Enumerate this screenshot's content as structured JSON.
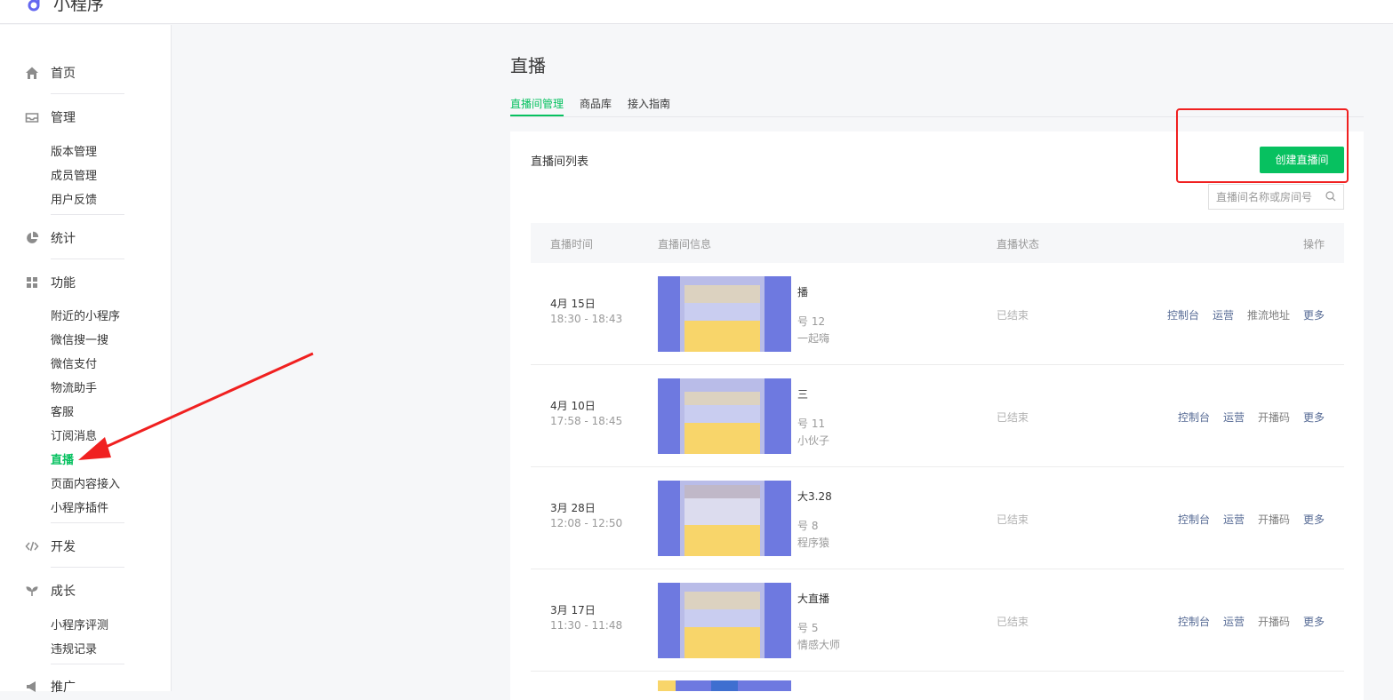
{
  "app": {
    "brand": "小程序"
  },
  "sidebar": {
    "groups": [
      {
        "label": "首页",
        "icon": "home-icon",
        "items": []
      },
      {
        "label": "管理",
        "icon": "inbox-icon",
        "items": [
          "版本管理",
          "成员管理",
          "用户反馈"
        ]
      },
      {
        "label": "统计",
        "icon": "pie-chart-icon",
        "items": []
      },
      {
        "label": "功能",
        "icon": "grid-icon",
        "items": [
          "附近的小程序",
          "微信搜一搜",
          "微信支付",
          "物流助手",
          "客服",
          "订阅消息",
          "直播",
          "页面内容接入",
          "小程序插件"
        ]
      },
      {
        "label": "开发",
        "icon": "code-icon",
        "items": []
      },
      {
        "label": "成长",
        "icon": "sprout-icon",
        "items": [
          "小程序评测",
          "违规记录"
        ]
      },
      {
        "label": "推广",
        "icon": "megaphone-icon",
        "items": []
      }
    ],
    "active_item": "直播"
  },
  "page": {
    "title": "直播",
    "tabs": [
      "直播间管理",
      "商品库",
      "接入指南"
    ],
    "active_tab": "直播间管理"
  },
  "list": {
    "title": "直播间列表",
    "create_button": "创建直播间",
    "search_placeholder": "直播间名称或房间号",
    "columns": [
      "直播时间",
      "直播间信息",
      "直播状态",
      "操作"
    ],
    "rows": [
      {
        "date": "4月 15日",
        "time": "18:30 - 18:43",
        "name": "播",
        "room": "号  12",
        "host": "一起嗨",
        "status": "已结束",
        "ops": [
          "控制台",
          "运营",
          "推流地址",
          "更多"
        ]
      },
      {
        "date": "4月 10日",
        "time": "17:58 - 18:45",
        "name": "三",
        "room": "号  11",
        "host": "小伙子",
        "status": "已结束",
        "ops": [
          "控制台",
          "运营",
          "开播码",
          "更多"
        ]
      },
      {
        "date": "3月 28日",
        "time": "12:08 - 12:50",
        "name": "大3.28",
        "room": "号  8",
        "host": "程序猿",
        "status": "已结束",
        "ops": [
          "控制台",
          "运营",
          "开播码",
          "更多"
        ]
      },
      {
        "date": "3月 17日",
        "time": "11:30 - 11:48",
        "name": "大直播",
        "room": "号  5",
        "host": "情感大师",
        "status": "已结束",
        "ops": [
          "控制台",
          "运营",
          "开播码",
          "更多"
        ]
      }
    ]
  },
  "colors": {
    "accent": "#07c160",
    "link": "#576b95",
    "annotation": "#f02020"
  }
}
